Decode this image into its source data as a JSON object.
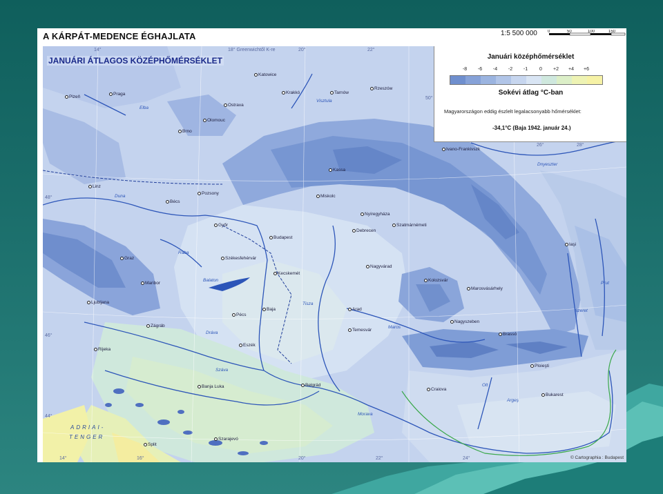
{
  "map": {
    "title": "A KÁRPÁT-MEDENCE ÉGHAJLATA",
    "scale": "1:5 500 000",
    "scale_bar_labels": [
      "0",
      "50",
      "100",
      "150"
    ],
    "subtitle": "JANUÁRI ÁTLAGOS KÖZÉPHŐMÉRSÉKLET",
    "copyright": "© Cartographia : Budapest",
    "grid_labels": [
      {
        "text": "14°"
      },
      {
        "text": "18° Greenwichtől K-re"
      },
      {
        "text": "20°"
      },
      {
        "text": "22°"
      },
      {
        "text": "48°"
      },
      {
        "text": "46°"
      },
      {
        "text": "44°"
      },
      {
        "text": "50°"
      },
      {
        "text": "26°"
      },
      {
        "text": "28°"
      },
      {
        "text": "16°"
      },
      {
        "text": "20°"
      },
      {
        "text": "22°"
      },
      {
        "text": "24°"
      },
      {
        "text": "14°"
      }
    ],
    "sea_label_1": "ADRIAI-",
    "sea_label_2": "TENGER"
  },
  "legend": {
    "title": "Januári középhőmérséklet",
    "ticks": [
      "-8",
      "-6",
      "-4",
      "-2",
      "-1",
      "0",
      "+2",
      "+4",
      "+6"
    ],
    "colors": [
      "#6f8fce",
      "#86a2d8",
      "#9bb4e0",
      "#b1c5e8",
      "#c7d6ef",
      "#d9e5f4",
      "#cfe8de",
      "#dcefc8",
      "#eef3b4",
      "#f6f2a6"
    ],
    "units": "Sokévi  átlag °C-ban",
    "note": "Magyarországon eddig észlelt legalacsonyabb hőmérséklet:",
    "record": "-34,1°C (Baja 1942. január 24.)"
  },
  "places": [
    {
      "name": "Plzeň"
    },
    {
      "name": "Praga"
    },
    {
      "name": "Katowice"
    },
    {
      "name": "Krakkó"
    },
    {
      "name": "Tarnów"
    },
    {
      "name": "Rzeszów"
    },
    {
      "name": "Ostrava"
    },
    {
      "name": "Olomouc"
    },
    {
      "name": "Brno"
    },
    {
      "name": "Linz"
    },
    {
      "name": "Bécs"
    },
    {
      "name": "Pozsony"
    },
    {
      "name": "Győr"
    },
    {
      "name": "Budapest"
    },
    {
      "name": "Miskolc"
    },
    {
      "name": "Kassa"
    },
    {
      "name": "Nyíregyháza"
    },
    {
      "name": "Debrecen"
    },
    {
      "name": "Szatmárnémeti"
    },
    {
      "name": "Ivano-Frankivszk"
    },
    {
      "name": "Iaşi"
    },
    {
      "name": "Graz"
    },
    {
      "name": "Székesfehérvár"
    },
    {
      "name": "Kecskemét"
    },
    {
      "name": "Nagyvárad"
    },
    {
      "name": "Kolozsvár"
    },
    {
      "name": "Marosvásárhely"
    },
    {
      "name": "Maribor"
    },
    {
      "name": "Ljubljana"
    },
    {
      "name": "Baja"
    },
    {
      "name": "Pécs"
    },
    {
      "name": "Arad"
    },
    {
      "name": "Zágráb"
    },
    {
      "name": "Temesvár"
    },
    {
      "name": "Nagyszeben"
    },
    {
      "name": "Brassó"
    },
    {
      "name": "Eszék"
    },
    {
      "name": "Rijeka"
    },
    {
      "name": "Ploieşti"
    },
    {
      "name": "Banja Luka"
    },
    {
      "name": "Belgrád"
    },
    {
      "name": "Craiova"
    },
    {
      "name": "Bukarest"
    },
    {
      "name": "Split"
    },
    {
      "name": "Szarajevó"
    }
  ],
  "water_labels": [
    {
      "name": "Duna"
    },
    {
      "name": "Tisza"
    },
    {
      "name": "Dnyeszter"
    },
    {
      "name": "Balaton"
    },
    {
      "name": "Dráva"
    },
    {
      "name": "Száva"
    },
    {
      "name": "Maros"
    },
    {
      "name": "Olt"
    },
    {
      "name": "Visztula"
    },
    {
      "name": "Prut"
    },
    {
      "name": "Szeret"
    },
    {
      "name": "Rába"
    },
    {
      "name": "Argeş"
    },
    {
      "name": "Morava"
    },
    {
      "name": "Elba"
    }
  ]
}
